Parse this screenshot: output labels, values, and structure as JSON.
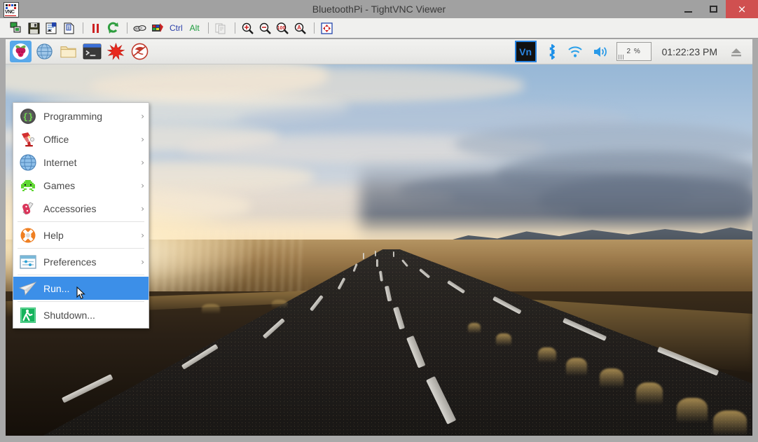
{
  "window": {
    "title": "BluetoothPi - TightVNC Viewer",
    "logo_text": "VNC",
    "buttons": {
      "minimize": "minimize-button",
      "maximize": "maximize-button",
      "close": "×"
    }
  },
  "toolbar": {
    "items": [
      {
        "name": "new-connection-icon",
        "label": ""
      },
      {
        "name": "save-connection-icon",
        "label": ""
      },
      {
        "name": "connection-options-icon",
        "label": ""
      },
      {
        "name": "connection-info-icon",
        "label": ""
      },
      {
        "name": "separator-1",
        "label": ""
      },
      {
        "name": "pause-icon",
        "label": ""
      },
      {
        "name": "refresh-icon",
        "label": ""
      },
      {
        "name": "separator-2",
        "label": ""
      },
      {
        "name": "send-keys-icon",
        "label": ""
      },
      {
        "name": "ctrl-alt-del-icon",
        "label": ""
      },
      {
        "name": "ctrl-key-button",
        "label": "Ctrl"
      },
      {
        "name": "alt-key-button",
        "label": "Alt"
      },
      {
        "name": "separator-3",
        "label": ""
      },
      {
        "name": "transfer-files-icon",
        "label": ""
      },
      {
        "name": "separator-4",
        "label": ""
      },
      {
        "name": "zoom-in-icon",
        "label": ""
      },
      {
        "name": "zoom-out-icon",
        "label": ""
      },
      {
        "name": "zoom-100-icon",
        "label": ""
      },
      {
        "name": "zoom-auto-icon",
        "label": ""
      },
      {
        "name": "separator-5",
        "label": ""
      },
      {
        "name": "fullscreen-icon",
        "label": ""
      }
    ],
    "ctrl_label": "Ctrl",
    "alt_label": "Alt",
    "zoom_100_label": "100"
  },
  "panel": {
    "launchers": [
      {
        "name": "raspberry-menu-button",
        "label": "Raspberry Pi Menu",
        "active": true
      },
      {
        "name": "web-browser-launcher",
        "label": "Web Browser",
        "active": false
      },
      {
        "name": "file-manager-launcher",
        "label": "File Manager",
        "active": false
      },
      {
        "name": "terminal-launcher",
        "label": "Terminal",
        "active": false
      },
      {
        "name": "mathematica-launcher",
        "label": "Mathematica",
        "active": false
      },
      {
        "name": "wolfram-launcher",
        "label": "Wolfram",
        "active": false
      }
    ],
    "tray": {
      "vnc_label": "Vn",
      "bluetooth_label": "bluetooth-icon",
      "wifi_label": "wifi-icon",
      "volume_label": "volume-icon",
      "cpu_percent": "2 %",
      "clock": "01:22:23 PM",
      "eject_label": "eject-icon"
    }
  },
  "menu": {
    "items": [
      {
        "label": "Programming",
        "icon": "programming-icon",
        "arrow": "›",
        "selected": false,
        "separator_after": false
      },
      {
        "label": "Office",
        "icon": "office-icon",
        "arrow": "›",
        "selected": false,
        "separator_after": false
      },
      {
        "label": "Internet",
        "icon": "internet-icon",
        "arrow": "›",
        "selected": false,
        "separator_after": false
      },
      {
        "label": "Games",
        "icon": "games-icon",
        "arrow": "›",
        "selected": false,
        "separator_after": false
      },
      {
        "label": "Accessories",
        "icon": "accessories-icon",
        "arrow": "›",
        "selected": false,
        "separator_after": true
      },
      {
        "label": "Help",
        "icon": "help-icon",
        "arrow": "›",
        "selected": false,
        "separator_after": true
      },
      {
        "label": "Preferences",
        "icon": "preferences-icon",
        "arrow": "›",
        "selected": false,
        "separator_after": true
      },
      {
        "label": "Run...",
        "icon": "run-icon",
        "arrow": "",
        "selected": true,
        "separator_after": true
      },
      {
        "label": "Shutdown...",
        "icon": "shutdown-icon",
        "arrow": "",
        "selected": false,
        "separator_after": false
      }
    ]
  },
  "colors": {
    "selection": "#3c8fe8",
    "titlebar": "#a1a1a1",
    "close_button": "#d05050",
    "panel": "#ebebe9",
    "toolbar": "#f0f0ee",
    "ctrl_text": "#2a3fa8",
    "alt_text": "#1d9b3d"
  },
  "wallpaper": {
    "description": "sunset highway road"
  }
}
